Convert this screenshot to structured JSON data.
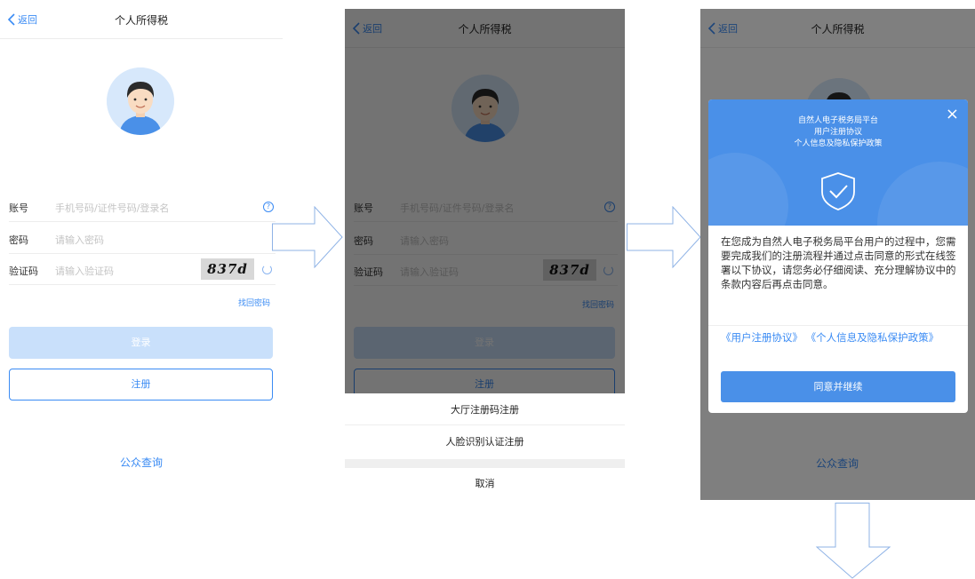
{
  "screens": {
    "login": {
      "nav": {
        "back_label": "返回",
        "title": "个人所得税"
      },
      "fields": {
        "account_label": "账号",
        "account_placeholder": "手机号码/证件号码/登录名",
        "password_label": "密码",
        "password_placeholder": "请输入密码",
        "captcha_label": "验证码",
        "captcha_placeholder": "请输入验证码",
        "captcha_text": "837d"
      },
      "forgot_label": "找回密码",
      "login_label": "登录",
      "register_label": "注册",
      "public_query_label": "公众查询"
    },
    "action_sheet": {
      "items": [
        "大厅注册码注册",
        "人脸识别认证注册"
      ],
      "cancel_label": "取消"
    },
    "agreement_modal": {
      "title_lines": [
        "自然人电子税务局平台",
        "用户注册协议",
        "个人信息及隐私保护政策"
      ],
      "body": "在您成为自然人电子税务局平台用户的过程中，您需要完成我们的注册流程并通过点击同意的形式在线签署以下协议，请您务必仔细阅读、充分理解协议中的条款内容后再点击同意。",
      "links": [
        "《用户注册协议》",
        "《个人信息及隐私保护政策》"
      ],
      "confirm_label": "同意并继续",
      "close_icon": "×"
    }
  },
  "colors": {
    "accent": "#3a8bf4",
    "modal_blue": "#4a90e8",
    "login_disabled": "#c9e0fb",
    "overlay": "rgba(0,0,0,0.55)"
  },
  "icons": [
    "back-chevron-icon",
    "help-circle-icon",
    "refresh-icon",
    "shield-check-icon",
    "close-icon",
    "flow-arrow-icon"
  ]
}
